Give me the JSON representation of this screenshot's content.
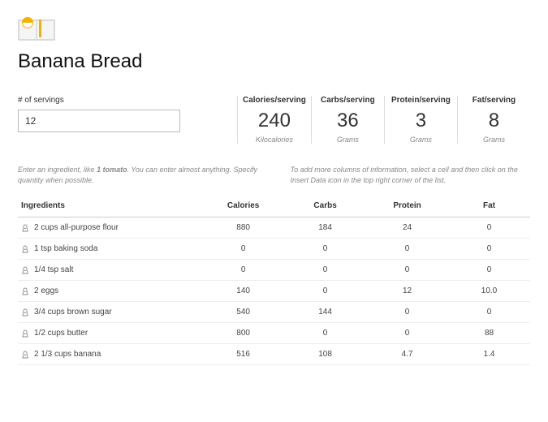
{
  "title": "Banana Bread",
  "servings": {
    "label": "# of servings",
    "value": "12"
  },
  "summary": [
    {
      "title": "Calories/serving",
      "value": "240",
      "unit": "Kilocalories"
    },
    {
      "title": "Carbs/serving",
      "value": "36",
      "unit": "Grams"
    },
    {
      "title": "Protein/serving",
      "value": "3",
      "unit": "Grams"
    },
    {
      "title": "Fat/serving",
      "value": "8",
      "unit": "Grams"
    }
  ],
  "hints": {
    "left_pre": "Enter an ingredient, like ",
    "left_bold": "1 tomato",
    "left_post": ". You can enter almost anything. Specify quantity when possible.",
    "right": "To add more columns of information, select a cell and then click on the Insert Data icon in the top right corner of the list."
  },
  "columns": {
    "ingredients": "Ingredients",
    "calories": "Calories",
    "carbs": "Carbs",
    "protein": "Protein",
    "fat": "Fat"
  },
  "rows": [
    {
      "name": "2 cups all-purpose flour",
      "calories": "880",
      "carbs": "184",
      "protein": "24",
      "fat": "0"
    },
    {
      "name": "1 tsp baking soda",
      "calories": "0",
      "carbs": "0",
      "protein": "0",
      "fat": "0"
    },
    {
      "name": "1/4 tsp salt",
      "calories": "0",
      "carbs": "0",
      "protein": "0",
      "fat": "0"
    },
    {
      "name": "2 eggs",
      "calories": "140",
      "carbs": "0",
      "protein": "12",
      "fat": "10.0"
    },
    {
      "name": "3/4 cups brown sugar",
      "calories": "540",
      "carbs": "144",
      "protein": "0",
      "fat": "0"
    },
    {
      "name": "1/2 cups butter",
      "calories": "800",
      "carbs": "0",
      "protein": "0",
      "fat": "88"
    },
    {
      "name": "2 1/3 cups banana",
      "calories": "516",
      "carbs": "108",
      "protein": "4.7",
      "fat": "1.4"
    }
  ]
}
